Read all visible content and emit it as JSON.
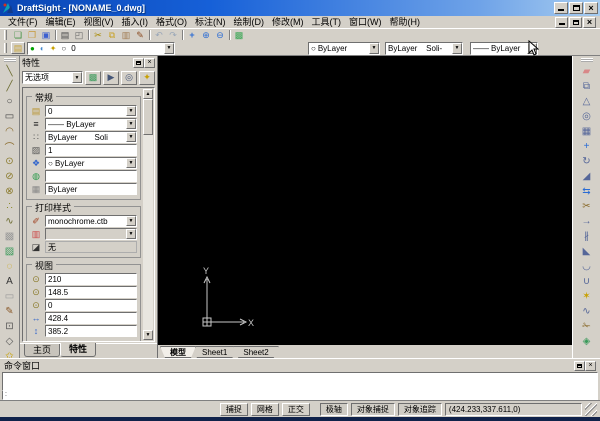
{
  "window": {
    "title": "DraftSight - [NONAME_0.dwg]",
    "accent_color": "#1660d8",
    "chrome_color": "#d4d0c8",
    "canvas_color": "#000000"
  },
  "menu": {
    "items": [
      "文件(F)",
      "编辑(E)",
      "视图(V)",
      "插入(I)",
      "格式(O)",
      "标注(N)",
      "绘制(D)",
      "修改(M)",
      "工具(T)",
      "窗口(W)",
      "帮助(H)"
    ]
  },
  "toolbar_standard": {
    "icons": [
      {
        "name": "new-icon",
        "glyph": "❏",
        "color": "#3f8f3f"
      },
      {
        "name": "open-icon",
        "glyph": "❐",
        "color": "#c79a3c"
      },
      {
        "name": "save-icon",
        "glyph": "▣",
        "color": "#3c5fd0"
      },
      {
        "name": "toolbar-separator",
        "glyph": "",
        "kind": "sep"
      },
      {
        "name": "print-icon",
        "glyph": "▤",
        "color": "#444444"
      },
      {
        "name": "print-preview-icon",
        "glyph": "◰",
        "color": "#666666"
      },
      {
        "name": "toolbar-separator",
        "glyph": "",
        "kind": "sep"
      },
      {
        "name": "cut-icon",
        "glyph": "✂",
        "color": "#a88a00"
      },
      {
        "name": "copy-icon",
        "glyph": "⧉",
        "color": "#c9a227"
      },
      {
        "name": "paste-icon",
        "glyph": "▥",
        "color": "#a07a50"
      },
      {
        "name": "format-painter-icon",
        "glyph": "✎",
        "color": "#8a4a20"
      },
      {
        "name": "toolbar-separator",
        "glyph": "",
        "kind": "sep"
      },
      {
        "name": "undo-icon",
        "glyph": "↶",
        "color": "#9aa7b8"
      },
      {
        "name": "redo-icon",
        "glyph": "↷",
        "color": "#9aa7b8"
      },
      {
        "name": "toolbar-separator",
        "glyph": "",
        "kind": "sep"
      },
      {
        "name": "pan-icon",
        "glyph": "+",
        "color": "#2b6cd4",
        "kind": "bold"
      },
      {
        "name": "zoom-in-icon",
        "glyph": "⊕",
        "color": "#2b6cd4"
      },
      {
        "name": "zoom-out-icon",
        "glyph": "⊖",
        "color": "#2b6cd4"
      },
      {
        "name": "toolbar-separator",
        "glyph": "",
        "kind": "sep"
      },
      {
        "name": "options-icon",
        "glyph": "▩",
        "color": "#3aa655"
      }
    ]
  },
  "toolbar_layer": {
    "manager_icon": {
      "name": "layer-manager-icon",
      "glyph": "▤",
      "color": "#c8a53a"
    },
    "status_icons": [
      {
        "name": "layer-show-icon",
        "glyph": "●",
        "color": "#00a000"
      },
      {
        "name": "layer-frozen-icon",
        "glyph": "◐",
        "color": "#4488cc"
      },
      {
        "name": "layer-lock-icon",
        "glyph": "✦",
        "color": "#c8a000"
      },
      {
        "name": "layer-color-icon",
        "glyph": "○",
        "color": "#333333"
      }
    ],
    "value": "0"
  },
  "toolbar_format": {
    "color": {
      "icon": "○",
      "value": "ByLayer"
    },
    "style": {
      "value": "ByLayer",
      "value2": "Soli-"
    },
    "weight": {
      "icon": "——",
      "value": "ByLayer"
    }
  },
  "properties_panel": {
    "title": "特性",
    "selection_value": "无选项",
    "header_buttons": [
      {
        "name": "select-set-icon",
        "glyph": "▩",
        "color": "#3a9a5a"
      },
      {
        "name": "select-entities-icon",
        "glyph": "▶",
        "color": "#445577"
      },
      {
        "name": "select-highlight-icon",
        "glyph": "◎",
        "color": "#445577"
      },
      {
        "name": "quick-select-icon",
        "glyph": "✦",
        "color": "#c8a000"
      }
    ],
    "groups": [
      {
        "label": "常规",
        "rows": [
          {
            "name": "layer-field",
            "icon_name": "layer-icon",
            "glyph": "▤",
            "color": "#b9952f",
            "kind": "dd",
            "value": "0",
            "value2": ""
          },
          {
            "name": "linestyle-field",
            "icon_name": "linestyle-icon",
            "glyph": "≡",
            "color": "#222222",
            "kind": "dd",
            "value": "—— ByLayer",
            "value2": ""
          },
          {
            "name": "lineweight-field",
            "icon_name": "lineweight-icon",
            "glyph": "∷",
            "color": "#555555",
            "kind": "dd",
            "value": "ByLayer",
            "value2": "Soli"
          },
          {
            "name": "linescale-field",
            "icon_name": "linescale-icon",
            "glyph": "▨",
            "color": "#555555",
            "kind": "input",
            "value": "1",
            "value2": ""
          },
          {
            "name": "linecolor-field",
            "icon_name": "linecolor-icon",
            "glyph": "❖",
            "color": "#3366cc",
            "kind": "dd",
            "value": "○ ByLayer",
            "value2": ""
          },
          {
            "name": "hyperlink-field",
            "icon_name": "hyperlink-icon",
            "glyph": "◍",
            "color": "#2a9a4a",
            "kind": "input",
            "value": "",
            "value2": ""
          },
          {
            "name": "material-field",
            "icon_name": "material-icon",
            "glyph": "▦",
            "color": "#888888",
            "kind": "input",
            "value": "ByLayer",
            "value2": ""
          }
        ]
      },
      {
        "label": "打印样式",
        "rows": [
          {
            "name": "print-style-field",
            "icon_name": "print-brush-icon",
            "glyph": "✐",
            "color": "#a04020",
            "kind": "dd",
            "value": "monochrome.ctb",
            "value2": ""
          },
          {
            "name": "print-color-field",
            "icon_name": "color-table-icon",
            "glyph": "▥",
            "color": "#cc4444",
            "kind": "dd-disabled",
            "value": "",
            "value2": ""
          },
          {
            "name": "print-table-field",
            "icon_name": "plot-table-icon",
            "glyph": "◪",
            "color": "#333333",
            "kind": "static",
            "value": "无",
            "value2": ""
          }
        ]
      },
      {
        "label": "视图",
        "rows": [
          {
            "name": "view-center-x-field",
            "icon_name": "center-x-icon",
            "glyph": "⊙",
            "color": "#8a7a2a",
            "kind": "input",
            "value": "210",
            "value2": ""
          },
          {
            "name": "view-center-y-field",
            "icon_name": "center-y-icon",
            "glyph": "⊙",
            "color": "#8a7a2a",
            "kind": "input",
            "value": "148.5",
            "value2": ""
          },
          {
            "name": "view-center-z-field",
            "icon_name": "center-z-icon",
            "glyph": "⊙",
            "color": "#8a7a2a",
            "kind": "input",
            "value": "0",
            "value2": ""
          },
          {
            "name": "view-width-field",
            "icon_name": "width-icon",
            "glyph": "↔",
            "color": "#3366cc",
            "kind": "input",
            "value": "428.4",
            "value2": ""
          },
          {
            "name": "view-height-field",
            "icon_name": "height-icon",
            "glyph": "↕",
            "color": "#3366cc",
            "kind": "input",
            "value": "385.2",
            "value2": ""
          }
        ]
      }
    ],
    "tabs": [
      {
        "name": "tab-home",
        "label": "主页"
      },
      {
        "name": "tab-properties",
        "label": "特性",
        "active": true
      }
    ]
  },
  "draw_toolbar": {
    "icons": [
      {
        "name": "line-icon",
        "glyph": "╲",
        "color": "#6b6b2f"
      },
      {
        "name": "polyline-icon",
        "glyph": "╱",
        "color": "#6b6b2f"
      },
      {
        "name": "circle-icon",
        "glyph": "○",
        "color": "#444444"
      },
      {
        "name": "rectangle-icon",
        "glyph": "▭",
        "color": "#444444"
      },
      {
        "name": "arc-icon",
        "glyph": "◠",
        "color": "#8a6a2a"
      },
      {
        "name": "arc-3point-icon",
        "glyph": "⌒",
        "color": "#8a6a2a"
      },
      {
        "name": "ellipse-center-icon",
        "glyph": "⊙",
        "color": "#8a7a2a"
      },
      {
        "name": "ellipse-axis-icon",
        "glyph": "⊘",
        "color": "#8a7a2a"
      },
      {
        "name": "ellipse-arc-icon",
        "glyph": "⊗",
        "color": "#8a7a2a"
      },
      {
        "name": "point-icon",
        "glyph": "∴",
        "color": "#8a8a2a"
      },
      {
        "name": "spline-icon",
        "glyph": "∿",
        "color": "#6b6b2f"
      },
      {
        "name": "region-icon",
        "glyph": "▩",
        "color": "#9a9a9a"
      },
      {
        "name": "hatch-icon",
        "glyph": "▨",
        "color": "#3a9a5a"
      },
      {
        "name": "revision-cloud-icon",
        "glyph": "◌",
        "color": "#c8a000"
      },
      {
        "name": "note-icon",
        "glyph": "A",
        "color": "#333333"
      },
      {
        "name": "simple-note-icon",
        "glyph": "▭",
        "color": "#999999"
      },
      {
        "name": "attach-image-icon",
        "glyph": "✎",
        "color": "#8a5a2a"
      },
      {
        "name": "boundary-icon",
        "glyph": "⊡",
        "color": "#555555"
      },
      {
        "name": "polygon-icon",
        "glyph": "◇",
        "color": "#555555"
      },
      {
        "name": "star-shape-icon",
        "glyph": "✩",
        "color": "#c8a000"
      }
    ]
  },
  "modify_toolbar": {
    "icons": [
      {
        "name": "delete-icon",
        "glyph": "▰",
        "color": "#d88888"
      },
      {
        "name": "copy-entity-icon",
        "glyph": "⧉",
        "color": "#556699"
      },
      {
        "name": "mirror-icon",
        "glyph": "△",
        "color": "#556699"
      },
      {
        "name": "offset-icon",
        "glyph": "◎",
        "color": "#556699"
      },
      {
        "name": "pattern-icon",
        "glyph": "▦",
        "color": "#556699"
      },
      {
        "name": "move-icon",
        "glyph": "+",
        "color": "#2b6cd4",
        "kind": "bold"
      },
      {
        "name": "rotate-icon",
        "glyph": "↻",
        "color": "#556699"
      },
      {
        "name": "scale-icon",
        "glyph": "◢",
        "color": "#556699"
      },
      {
        "name": "stretch-icon",
        "glyph": "⇆",
        "color": "#2b6cd4"
      },
      {
        "name": "trim-icon",
        "glyph": "✂",
        "color": "#8a6a2a"
      },
      {
        "name": "extend-icon",
        "glyph": "→",
        "color": "#556699"
      },
      {
        "name": "break-icon",
        "glyph": "∦",
        "color": "#556699"
      },
      {
        "name": "chamfer-icon",
        "glyph": "◣",
        "color": "#556699"
      },
      {
        "name": "fillet-icon",
        "glyph": "◡",
        "color": "#556699"
      },
      {
        "name": "weld-icon",
        "glyph": "∪",
        "color": "#556699"
      },
      {
        "name": "explode-icon",
        "glyph": "✶",
        "color": "#c8a000"
      },
      {
        "name": "edit-polyline-icon",
        "glyph": "∿",
        "color": "#556699"
      },
      {
        "name": "split-icon",
        "glyph": "✁",
        "color": "#8a6a2a"
      },
      {
        "name": "entity-properties-icon",
        "glyph": "◈",
        "color": "#3a9a5a"
      }
    ]
  },
  "drawing": {
    "ucs_x": "X",
    "ucs_y": "Y"
  },
  "sheet_tabs": [
    {
      "name": "tab-model",
      "label": "模型",
      "active": true
    },
    {
      "name": "tab-sheet1",
      "label": "Sheet1"
    },
    {
      "name": "tab-sheet2",
      "label": "Sheet2"
    }
  ],
  "command_window": {
    "title": "命令窗口",
    "text": "",
    "prompt": ":"
  },
  "status_bar": {
    "toggles": [
      {
        "name": "snap-toggle",
        "label": "捕捉",
        "active": false
      },
      {
        "name": "grid-toggle",
        "label": "网格",
        "active": false
      },
      {
        "name": "ortho-toggle",
        "label": "正交",
        "active": false
      },
      {
        "name": "polar-toggle",
        "label": "极轴",
        "active": true,
        "kind": "gapped"
      },
      {
        "name": "esnap-toggle",
        "label": "对象捕捉",
        "active": true
      },
      {
        "name": "etrack-toggle",
        "label": "对象追踪",
        "active": true
      }
    ],
    "coordinates": "(424.233,337.611,0)"
  }
}
